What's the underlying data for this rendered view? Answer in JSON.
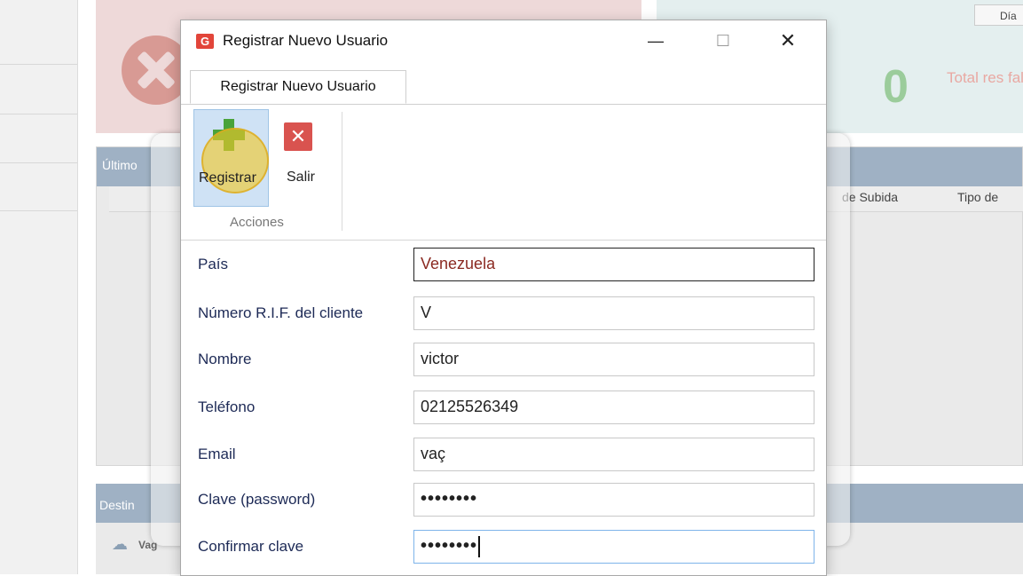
{
  "background": {
    "dia_label": "Día",
    "total_label": "Total res fallidos",
    "total_value": "0",
    "table_title": "Último",
    "columns": [
      "de Subida",
      "Tipo de"
    ],
    "dest_title": "Destin",
    "dest_item": "Vag"
  },
  "dialog": {
    "title": "Registrar Nuevo Usuario",
    "minimize": "—",
    "maximize": "☐",
    "close": "✕",
    "tab_label": "Registrar Nuevo Usuario",
    "ribbon": {
      "register_label": "Registrar",
      "exit_label": "Salir",
      "group_label": "Acciones"
    },
    "form": [
      {
        "label": "País",
        "value": "Venezuela"
      },
      {
        "label": "Número R.I.F. del cliente",
        "value": "V"
      },
      {
        "label": "Nombre",
        "value": "victor"
      },
      {
        "label": "Teléfono",
        "value": "02125526349"
      },
      {
        "label": "Email",
        "value": "vaç"
      },
      {
        "label": "Clave (password)",
        "value": "••••••••"
      },
      {
        "label": "Confirmar clave",
        "value": "••••••••"
      }
    ]
  },
  "colors": {
    "accent": "#4aa33a",
    "danger": "#d9534f",
    "highlight": "#f0c828"
  }
}
